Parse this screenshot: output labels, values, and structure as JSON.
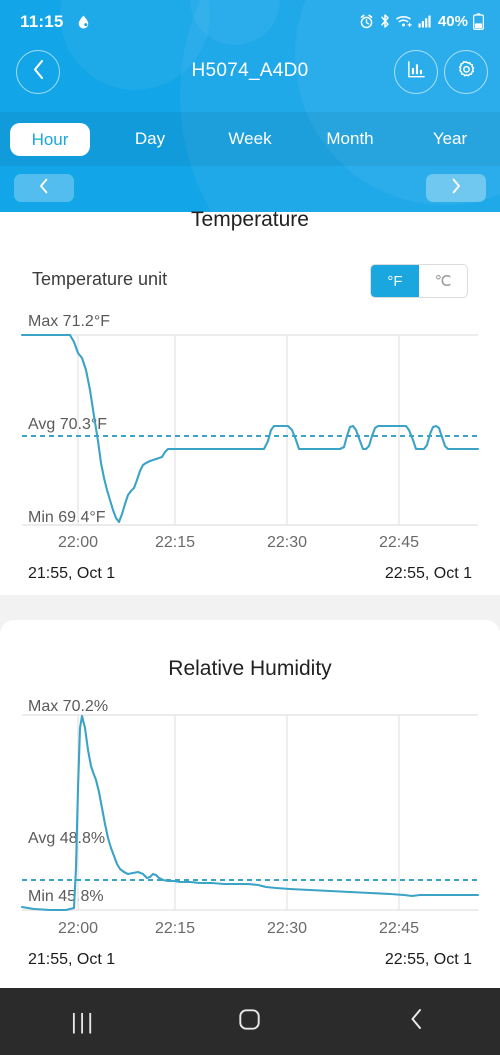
{
  "status_bar": {
    "time": "11:15",
    "battery_percent": "40%",
    "icons": [
      "water-drop-icon",
      "alarm-icon",
      "bluetooth-icon",
      "wifi-icon",
      "cellular-signal-icon",
      "battery-icon"
    ]
  },
  "header": {
    "title": "H5074_A4D0",
    "back_icon": "chevron-left-icon",
    "stats_icon": "bar-chart-icon",
    "settings_icon": "gear-icon"
  },
  "tabs": [
    {
      "label": "Hour",
      "active": true
    },
    {
      "label": "Day",
      "active": false
    },
    {
      "label": "Week",
      "active": false
    },
    {
      "label": "Month",
      "active": false
    },
    {
      "label": "Year",
      "active": false
    }
  ],
  "pager": {
    "prev_icon": "chevron-left-icon",
    "next_icon": "chevron-right-icon"
  },
  "temperature_card": {
    "title": "Temperature",
    "unit_label": "Temperature unit",
    "unit_options": [
      {
        "label": "°F",
        "selected": true
      },
      {
        "label": "℃",
        "selected": false
      }
    ],
    "max_label": "Max 71.2°F",
    "avg_label": "Avg 70.3°F",
    "min_label": "Min 69.4°F",
    "x_ticks": [
      "22:00",
      "22:15",
      "22:30",
      "22:45"
    ],
    "range_start": "21:55, Oct 1",
    "range_end": "22:55, Oct 1"
  },
  "humidity_card": {
    "title": "Relative Humidity",
    "max_label": "Max 70.2%",
    "avg_label": "Avg 48.8%",
    "min_label": "Min 45.8%",
    "x_ticks": [
      "22:00",
      "22:15",
      "22:30",
      "22:45"
    ],
    "range_start": "21:55, Oct 1",
    "range_end": "22:55, Oct 1"
  },
  "nav_bar": {
    "recents_icon": "recents-icon",
    "home_icon": "home-icon",
    "back_icon": "back-icon",
    "recents_glyph": "|||"
  },
  "colors": {
    "brand_blue": "#12a5e8",
    "tab_active_text": "#1aa7e0",
    "line_teal": "#3ba3c6",
    "grid_gray": "#e2e2e2",
    "card_bg": "#ffffff",
    "page_bg": "#f2f2f2",
    "navbar_bg": "#2b2b2b"
  },
  "chart_data": [
    {
      "type": "line",
      "title": "Temperature",
      "ylabel": "°F",
      "xlabel": "",
      "grid": true,
      "legend": "none",
      "max": 71.2,
      "avg": 70.3,
      "min": 69.4,
      "ylim": [
        69.4,
        71.2
      ],
      "xlim": [
        "21:55",
        "22:55"
      ],
      "x_ticks": [
        "22:00",
        "22:15",
        "22:30",
        "22:45"
      ],
      "avg_reference_line": 70.3,
      "x": [
        0,
        1,
        2,
        3,
        4,
        5,
        6,
        7,
        8,
        9,
        10,
        11,
        12,
        13,
        14,
        15,
        16,
        17,
        18,
        19,
        20,
        21,
        22,
        23,
        24,
        25,
        26,
        27,
        28,
        29,
        30,
        31,
        32,
        33,
        34,
        35,
        36,
        37,
        38,
        39,
        40,
        41,
        42,
        43,
        44,
        45,
        46,
        47,
        48,
        49,
        50,
        51,
        52,
        53,
        54,
        55,
        56,
        57,
        58,
        59,
        60
      ],
      "values": [
        71.2,
        71.2,
        71.2,
        71.2,
        71.2,
        71.1,
        70.9,
        70.8,
        70.4,
        70.1,
        69.8,
        69.6,
        69.5,
        69.45,
        69.4,
        69.5,
        69.6,
        69.75,
        69.8,
        69.9,
        70.0,
        70.0,
        70.05,
        70.1,
        70.1,
        70.1,
        70.1,
        70.1,
        70.1,
        70.1,
        70.1,
        70.1,
        70.1,
        70.1,
        70.1,
        70.1,
        70.4,
        70.4,
        70.4,
        70.1,
        70.1,
        70.1,
        70.1,
        70.1,
        70.1,
        70.4,
        70.4,
        70.1,
        70.4,
        70.4,
        70.4,
        70.4,
        70.1,
        70.4,
        70.1,
        70.1,
        70.1,
        70.1,
        70.1,
        70.1,
        70.1
      ]
    },
    {
      "type": "line",
      "title": "Relative Humidity",
      "ylabel": "%",
      "xlabel": "",
      "grid": true,
      "legend": "none",
      "max": 70.2,
      "avg": 48.8,
      "min": 45.8,
      "ylim": [
        45.8,
        70.2
      ],
      "xlim": [
        "21:55",
        "22:55"
      ],
      "x_ticks": [
        "22:00",
        "22:15",
        "22:30",
        "22:45"
      ],
      "avg_reference_line": 48.8,
      "x": [
        0,
        1,
        2,
        3,
        4,
        5,
        6,
        7,
        8,
        9,
        10,
        11,
        12,
        13,
        14,
        15,
        16,
        17,
        18,
        19,
        20,
        21,
        22,
        23,
        24,
        25,
        26,
        27,
        28,
        29,
        30,
        31,
        32,
        33,
        34,
        35,
        36,
        37,
        38,
        39,
        40,
        41,
        42,
        43,
        44,
        45,
        46,
        47,
        48,
        49,
        50,
        51,
        52,
        53,
        54,
        55,
        56,
        57,
        58,
        59,
        60
      ],
      "values": [
        45.9,
        45.8,
        45.8,
        45.8,
        46.0,
        70.2,
        62.0,
        60.5,
        58.0,
        55.0,
        52.0,
        50.0,
        49.2,
        48.6,
        48.0,
        47.6,
        47.5,
        47.4,
        47.3,
        47.2,
        47.4,
        47.3,
        47.2,
        47.1,
        47.0,
        46.9,
        46.8,
        46.8,
        46.7,
        46.7,
        46.7,
        46.7,
        46.6,
        46.6,
        46.6,
        46.6,
        46.6,
        46.5,
        46.5,
        46.5,
        46.5,
        46.4,
        46.3,
        46.3,
        46.2,
        46.2,
        46.2,
        46.1,
        46.1,
        46.1,
        46.0,
        46.0,
        46.0,
        45.9,
        45.9,
        45.9,
        45.9,
        45.9,
        45.9,
        45.9,
        45.9
      ]
    }
  ]
}
